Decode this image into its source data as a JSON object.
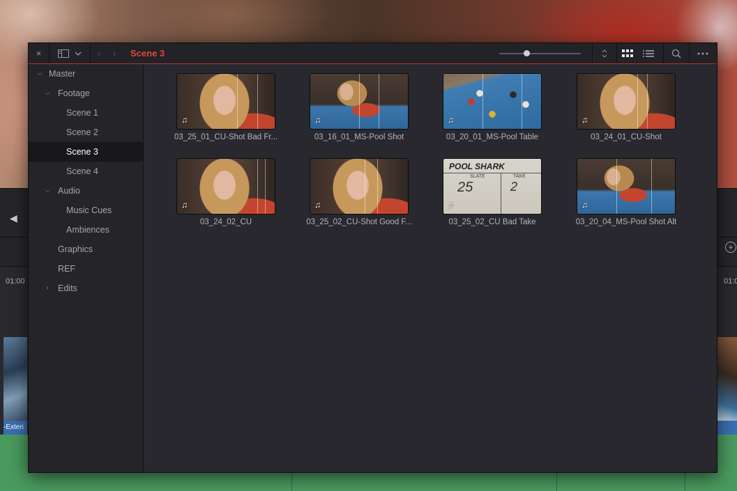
{
  "window": {
    "close_glyph": "×",
    "title": "Scene 3",
    "zoom_slider_value": 0.33
  },
  "timeline_bg": {
    "timecode_left": "01:00",
    "timecode_right": "01:0",
    "clip_label": "-Exteri"
  },
  "sidebar": {
    "items": [
      {
        "label": "Master",
        "level": 0,
        "expander": "down"
      },
      {
        "label": "Footage",
        "level": 1,
        "expander": "down"
      },
      {
        "label": "Scene 1",
        "level": 2
      },
      {
        "label": "Scene 2",
        "level": 2
      },
      {
        "label": "Scene 3",
        "level": 2,
        "selected": true
      },
      {
        "label": "Scene 4",
        "level": 2
      },
      {
        "label": "Audio",
        "level": 1,
        "expander": "down"
      },
      {
        "label": "Music Cues",
        "level": 2
      },
      {
        "label": "Ambiences",
        "level": 2
      },
      {
        "label": "Graphics",
        "level": 1
      },
      {
        "label": "REF",
        "level": 1
      },
      {
        "label": "Edits",
        "level": 1,
        "expander": "right"
      }
    ]
  },
  "clips": [
    {
      "label": "03_25_01_CU-Shot Bad Fr...",
      "thumb": "face",
      "has_audio": true
    },
    {
      "label": "03_16_01_MS-Pool Shot",
      "thumb": "poolshot",
      "has_audio": true
    },
    {
      "label": "03_20_01_MS-Pool Table",
      "thumb": "pool",
      "has_audio": true
    },
    {
      "label": "03_24_01_CU-Shot",
      "thumb": "face",
      "has_audio": true
    },
    {
      "label": "03_24_02_CU",
      "thumb": "face",
      "has_audio": true
    },
    {
      "label": "03_25_02_CU-Shot Good F...",
      "thumb": "face",
      "has_audio": true
    },
    {
      "label": "03_25_02_CU Bad Take",
      "thumb": "slate",
      "has_audio": true,
      "slate_text": {
        "title": "POOL SHARK",
        "scene": "25",
        "take": "2",
        "slate": "SLATE",
        "take_label": "TAKE"
      }
    },
    {
      "label": "03_20_04_MS-Pool Shot Alt",
      "thumb": "poolshot",
      "has_audio": true
    }
  ],
  "icons": {
    "audio": "♫",
    "accent": "#e0483a"
  }
}
